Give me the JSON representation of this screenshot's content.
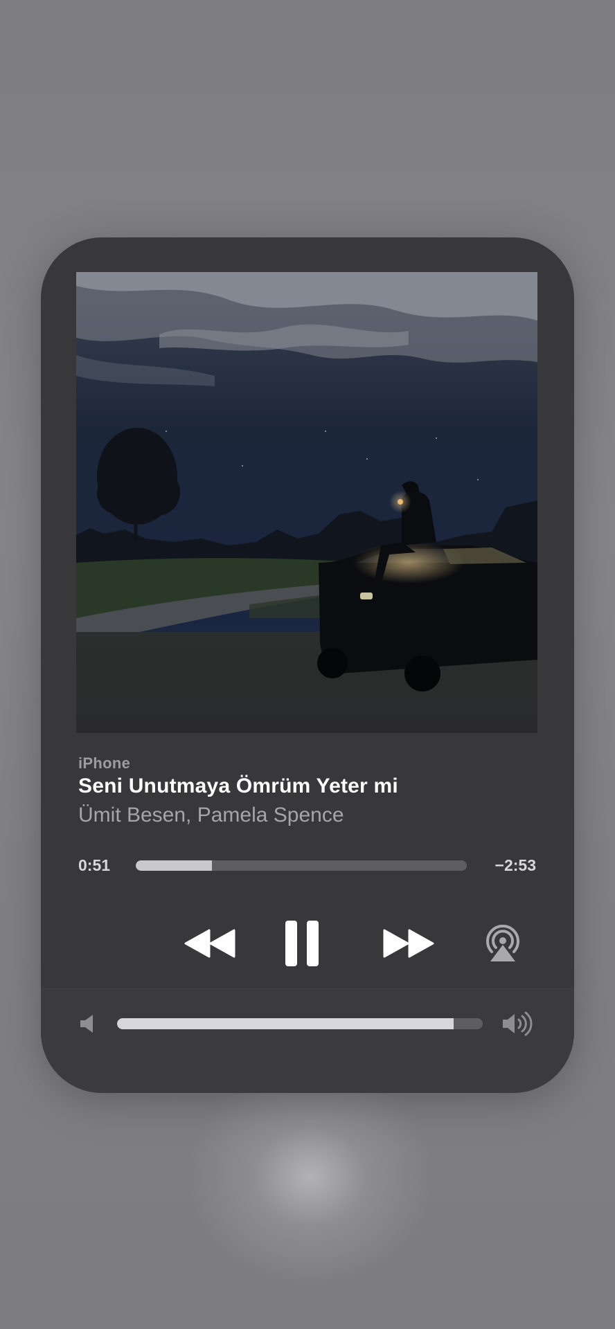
{
  "now_playing": {
    "device": "iPhone",
    "title": "Seni Unutmaya Ömrüm Yeter mi",
    "artist": "Ümit Besen, Pamela Spence",
    "artwork_description_icon": "album-artwork"
  },
  "playback": {
    "elapsed": "0:51",
    "remaining": "−2:53",
    "progress_fraction": 0.23,
    "state": "playing"
  },
  "controls": {
    "rewind_icon": "rewind-icon",
    "pause_icon": "pause-icon",
    "forward_icon": "fast-forward-icon",
    "airplay_icon": "airplay-icon"
  },
  "volume": {
    "level_fraction": 0.92,
    "low_icon": "speaker-low-icon",
    "high_icon": "speaker-high-icon"
  },
  "colors": {
    "panel_bg": "#38383a",
    "track": "#5e5e61",
    "fill": "#c9c9cc",
    "title": "#ffffff",
    "subtitle": "#a6a6aa"
  }
}
